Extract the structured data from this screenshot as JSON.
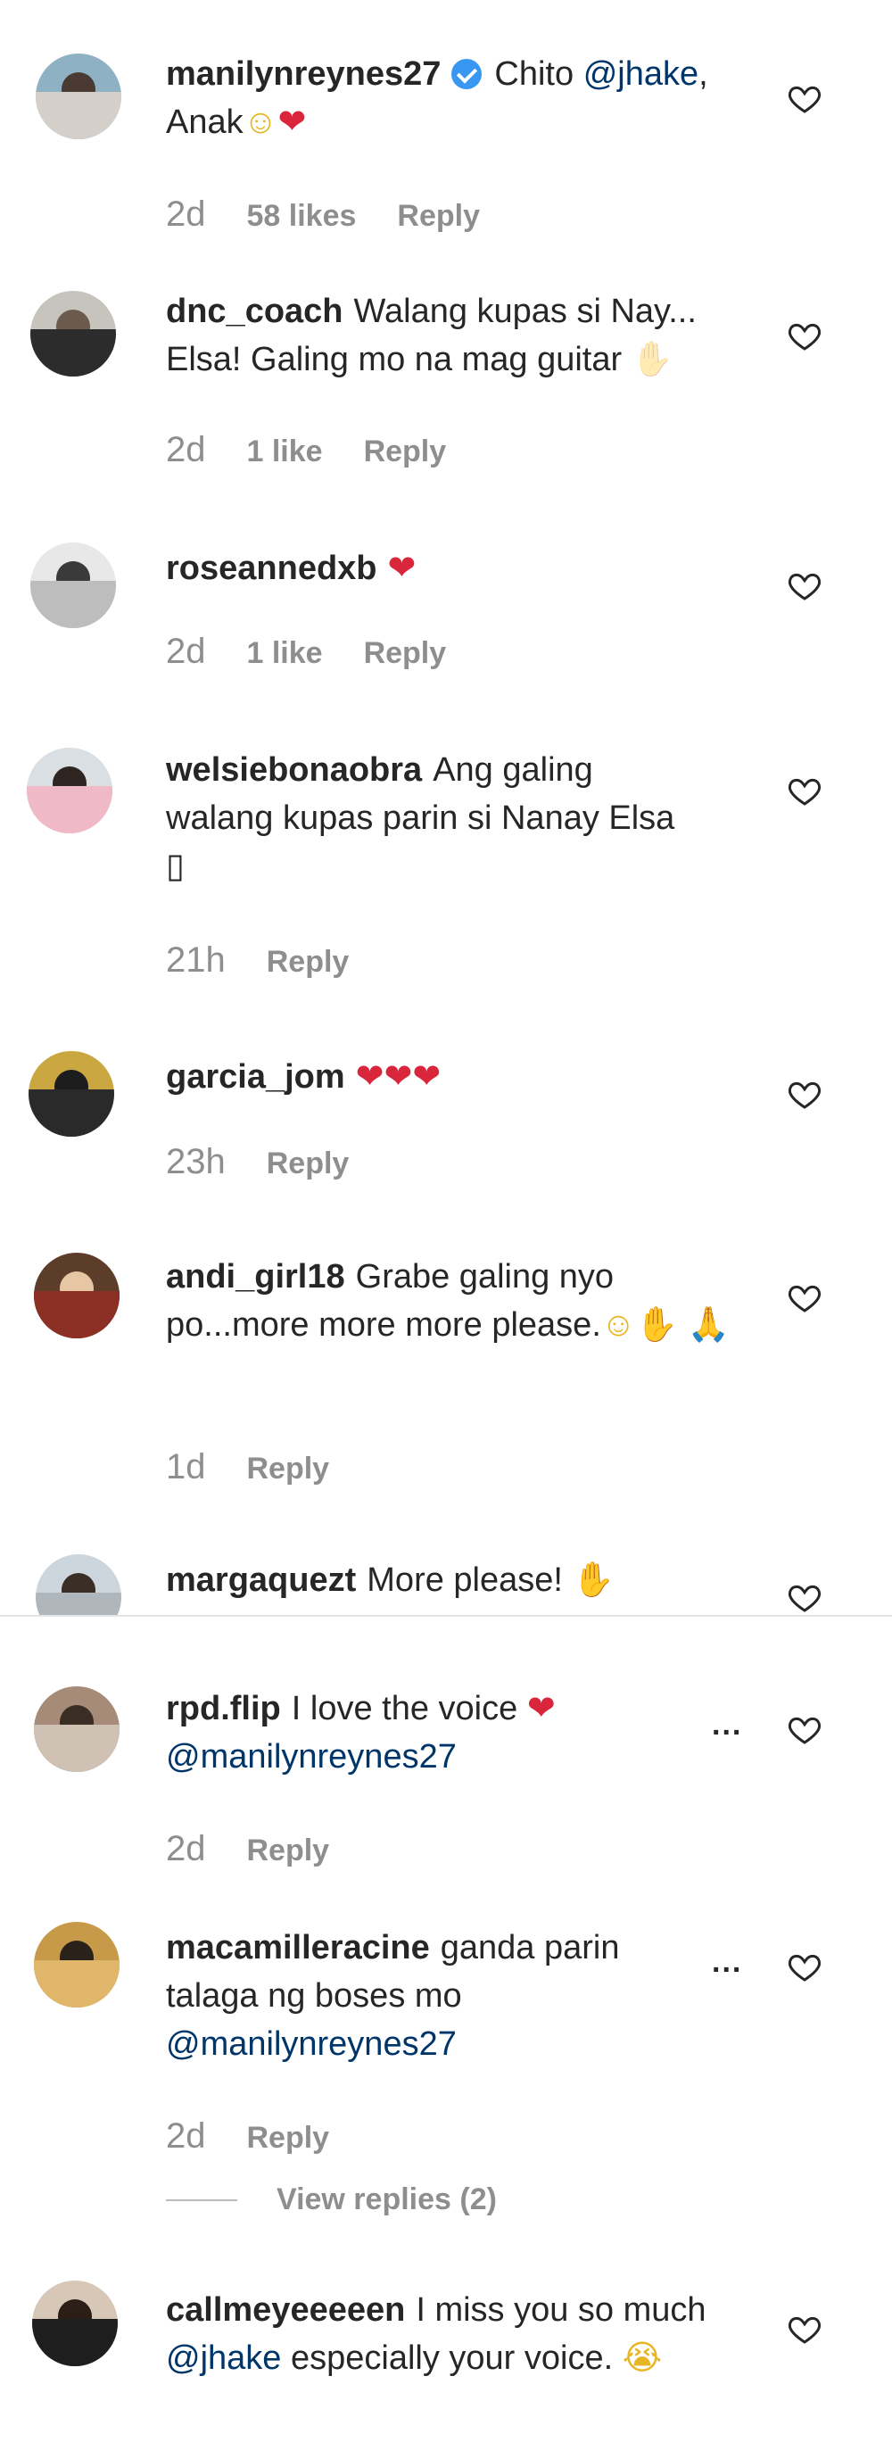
{
  "comments": [
    {
      "user": "manilynreynes27",
      "verified": true,
      "text_html": "Chito <span class='mention'>@jhake</span>, Anak<span class='emoji-y'>☺</span><span class='emoji-h'>❤</span>",
      "text_plain": "Chito @jhake, Anak",
      "time": "2d",
      "likes": "58 likes",
      "reply": "Reply"
    },
    {
      "user": "dnc_coach",
      "text_plain": "Walang kupas si Nay... Elsa! Galing mo na mag guitar",
      "time": "2d",
      "likes": "1 like",
      "reply": "Reply"
    },
    {
      "user": "roseannedxb",
      "text_plain": "❤",
      "time": "2d",
      "likes": "1 like",
      "reply": "Reply"
    },
    {
      "user": "welsiebonaobra",
      "text_plain": "Ang galing walang kupas parin si Nanay Elsa ▯",
      "time": "21h",
      "reply": "Reply"
    },
    {
      "user": "garcia_jom",
      "text_plain": "❤❤❤",
      "time": "23h",
      "reply": "Reply"
    },
    {
      "user": "andi_girl18",
      "text_plain": "Grabe galing nyo po...more more more please.",
      "time": "1d",
      "reply": "Reply"
    },
    {
      "user": "margaquezt",
      "text_plain": "More please!"
    },
    {
      "user": "rpd.flip",
      "text_plain": "I love the voice ❤ @manilynreynes27",
      "time": "2d",
      "reply": "Reply"
    },
    {
      "user": "macamilleracine",
      "text_plain": "ganda parin talaga ng boses mo @manilynreynes27",
      "time": "2d",
      "reply": "Reply",
      "view_replies": "View replies (2)"
    },
    {
      "user": "callmeyeeeeen",
      "text_plain": "I miss you so much @jhake especially your voice."
    }
  ],
  "icons": {
    "heart": "heart-outline-icon",
    "more": "more-options-icon",
    "verified": "verified-badge-icon"
  },
  "colors": {
    "mention": "#003569",
    "meta": "#8e8e8e",
    "heart": "#d9263b",
    "verified": "#3897f0"
  },
  "ui": {
    "more_dots": "..."
  }
}
